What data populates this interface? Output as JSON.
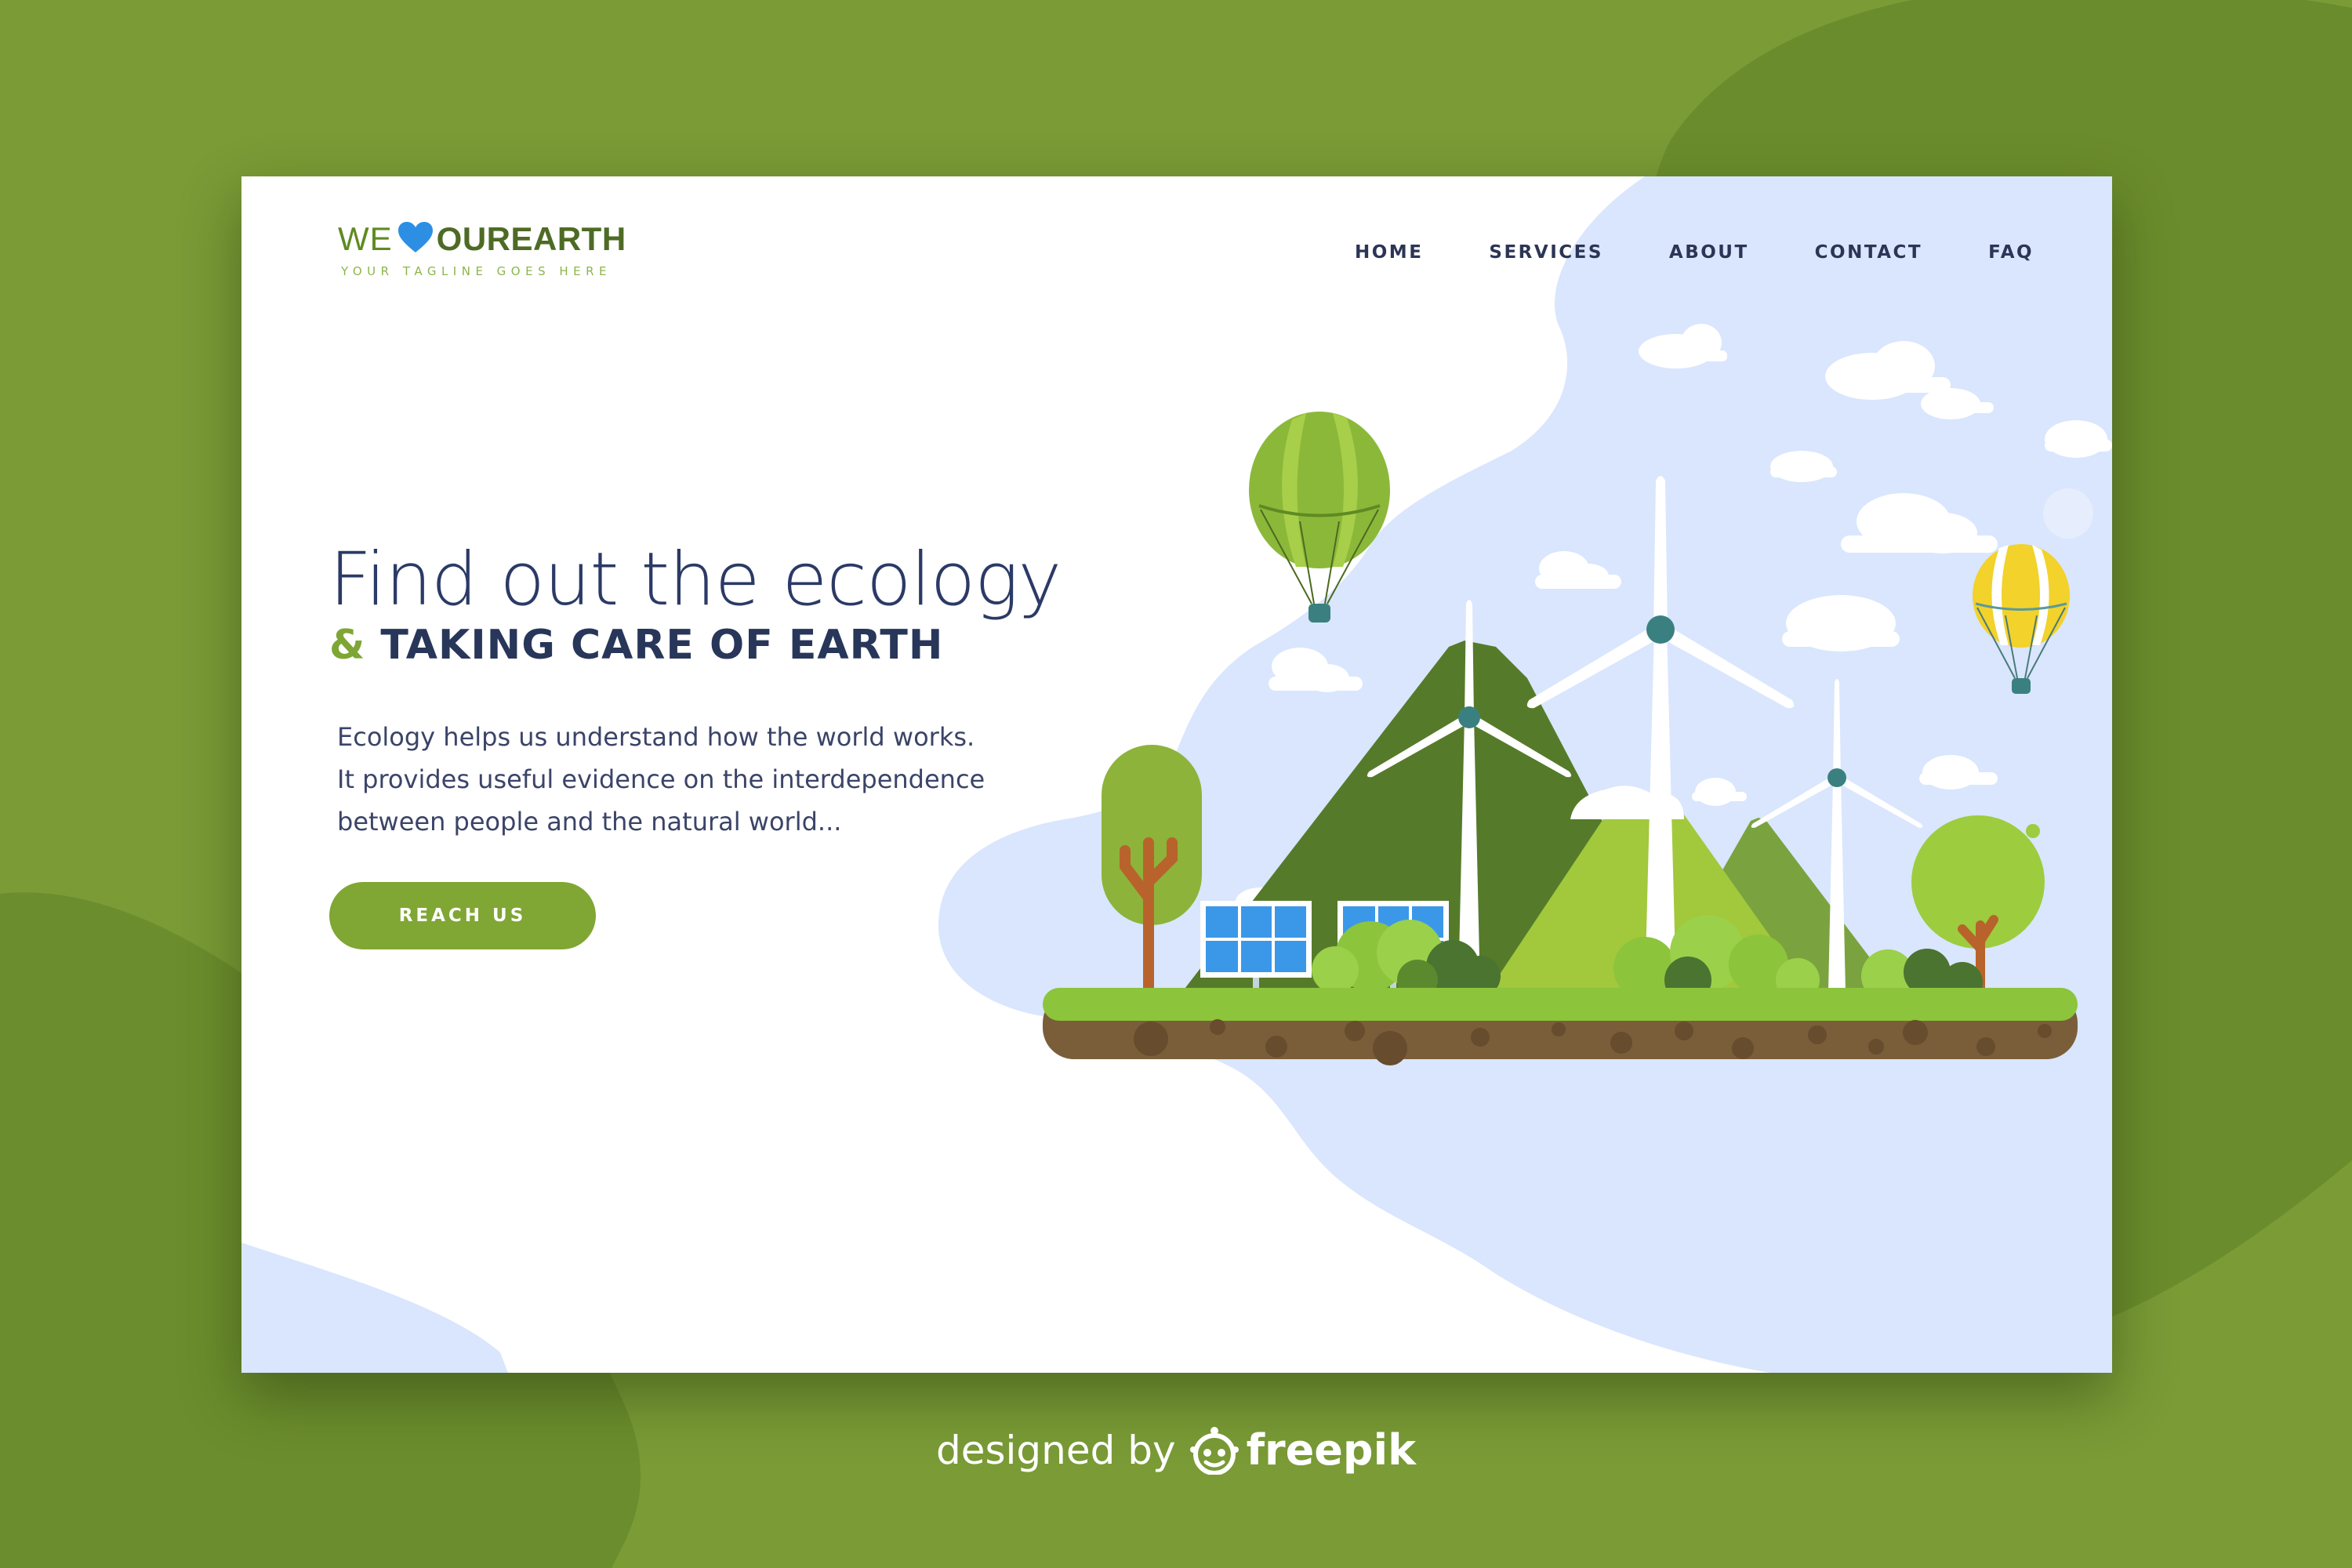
{
  "logo": {
    "prefix": "WE",
    "brand": "OUREARTH",
    "tagline": "YOUR TAGLINE GOES HERE"
  },
  "nav": {
    "home": "HOME",
    "services": "SERVICES",
    "about": "ABOUT",
    "contact": "CONTACT",
    "faq": "FAQ"
  },
  "hero": {
    "title": "Find out the ecology",
    "ampersand": "&",
    "subtitle": "TAKING CARE OF EARTH",
    "description": [
      "Ecology helps us understand how the world works.",
      "It provides useful evidence on the interdependence",
      "between people and the natural world..."
    ],
    "cta_label": "REACH US"
  },
  "credit": {
    "prefix": "designed by",
    "brand": "freepik"
  },
  "colors": {
    "background": "#7a9b36",
    "accent_green": "#80a634",
    "navy": "#2b3a66",
    "heart_blue": "#2d8fe3",
    "sky_blob": "#d9e6fd"
  },
  "icons": [
    "heart-icon",
    "freepik-icon"
  ]
}
